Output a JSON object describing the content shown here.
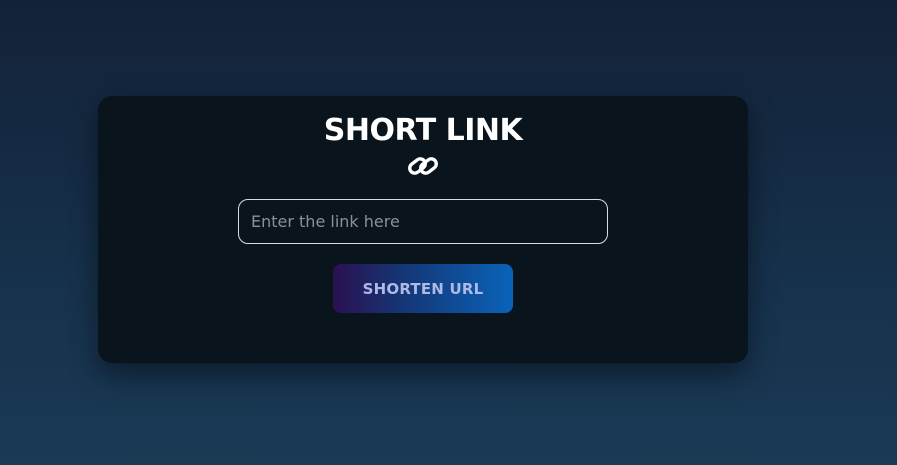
{
  "card": {
    "title": "SHORT LINK",
    "icon": "link-icon"
  },
  "form": {
    "input_placeholder": "Enter the link here",
    "input_value": "",
    "button_label": "SHORTEN URL"
  },
  "colors": {
    "background_top": "#132238",
    "background_bottom": "#1a3a55",
    "card": "#0a141d",
    "button_gradient_start": "#2a1150",
    "button_gradient_end": "#0a63b8"
  }
}
